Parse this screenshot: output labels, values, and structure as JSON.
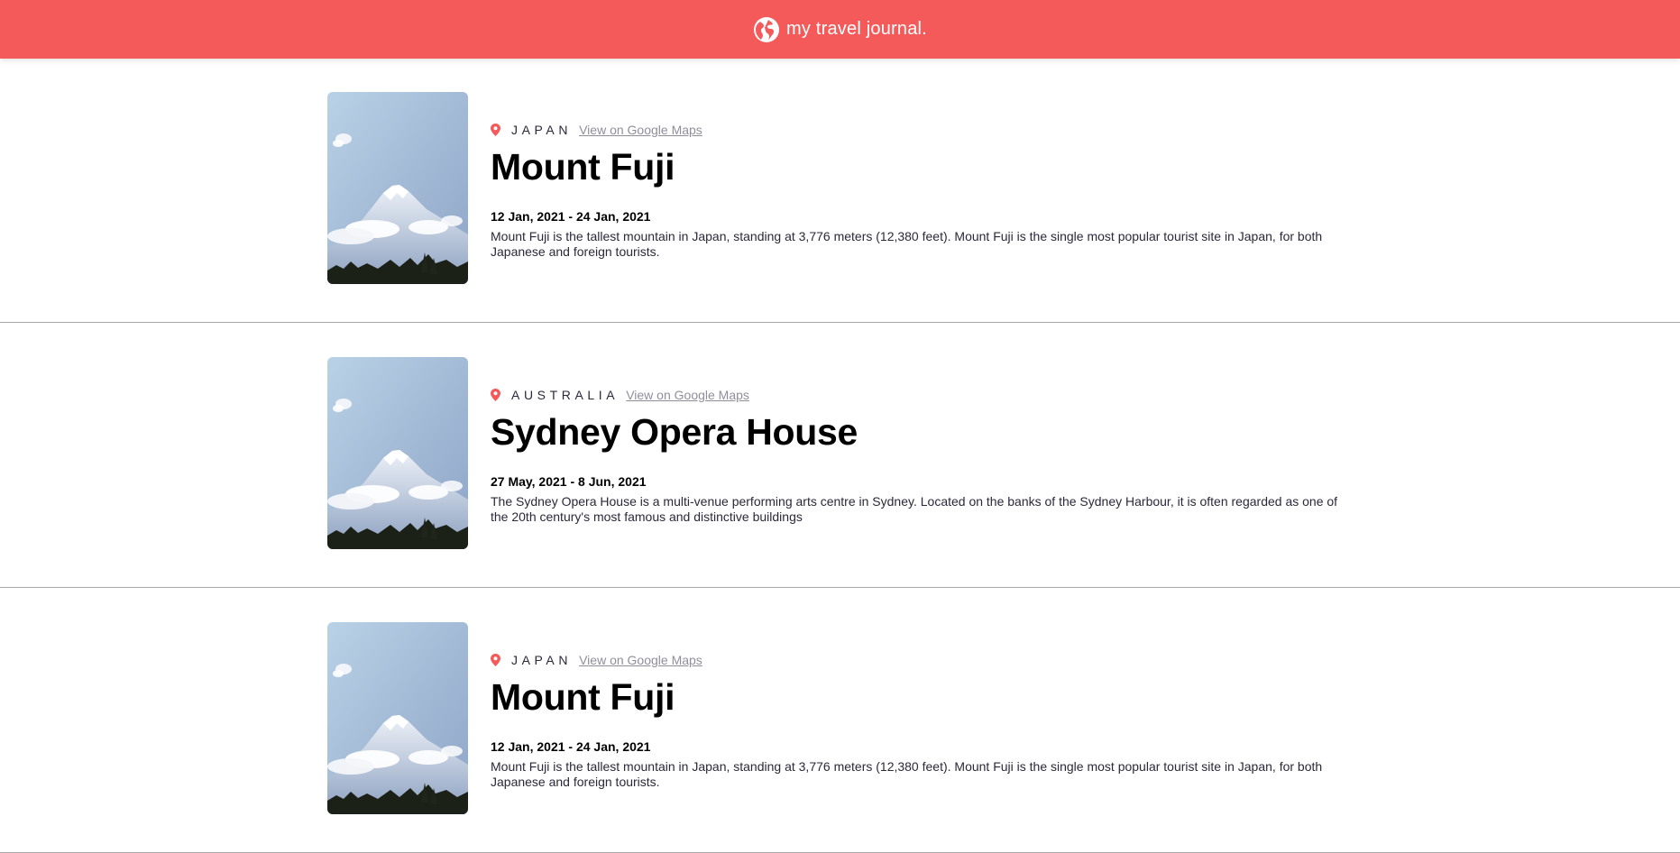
{
  "header": {
    "title": "my travel journal.",
    "icon": "globe-icon",
    "background": "#f55a5a"
  },
  "entries": [
    {
      "country": "JAPAN",
      "maps_link": "View on Google Maps",
      "title": "Mount Fuji",
      "dates": "12 Jan, 2021 - 24 Jan, 2021",
      "description": "Mount Fuji is the tallest mountain in Japan, standing at 3,776 meters (12,380 feet). Mount Fuji is the single most popular tourist site in Japan, for both Japanese and foreign tourists."
    },
    {
      "country": "AUSTRALIA",
      "maps_link": "View on Google Maps",
      "title": "Sydney Opera House",
      "dates": "27 May, 2021 - 8 Jun, 2021",
      "description": "The Sydney Opera House is a multi-venue performing arts centre in Sydney. Located on the banks of the Sydney Harbour, it is often regarded as one of the 20th century's most famous and distinctive buildings"
    },
    {
      "country": "JAPAN",
      "maps_link": "View on Google Maps",
      "title": "Mount Fuji",
      "dates": "12 Jan, 2021 - 24 Jan, 2021",
      "description": "Mount Fuji is the tallest mountain in Japan, standing at 3,776 meters (12,380 feet). Mount Fuji is the single most popular tourist site in Japan, for both Japanese and foreign tourists."
    }
  ],
  "colors": {
    "accent": "#f55a5a",
    "link": "#918e9b",
    "divider": "#a8a8a8"
  }
}
